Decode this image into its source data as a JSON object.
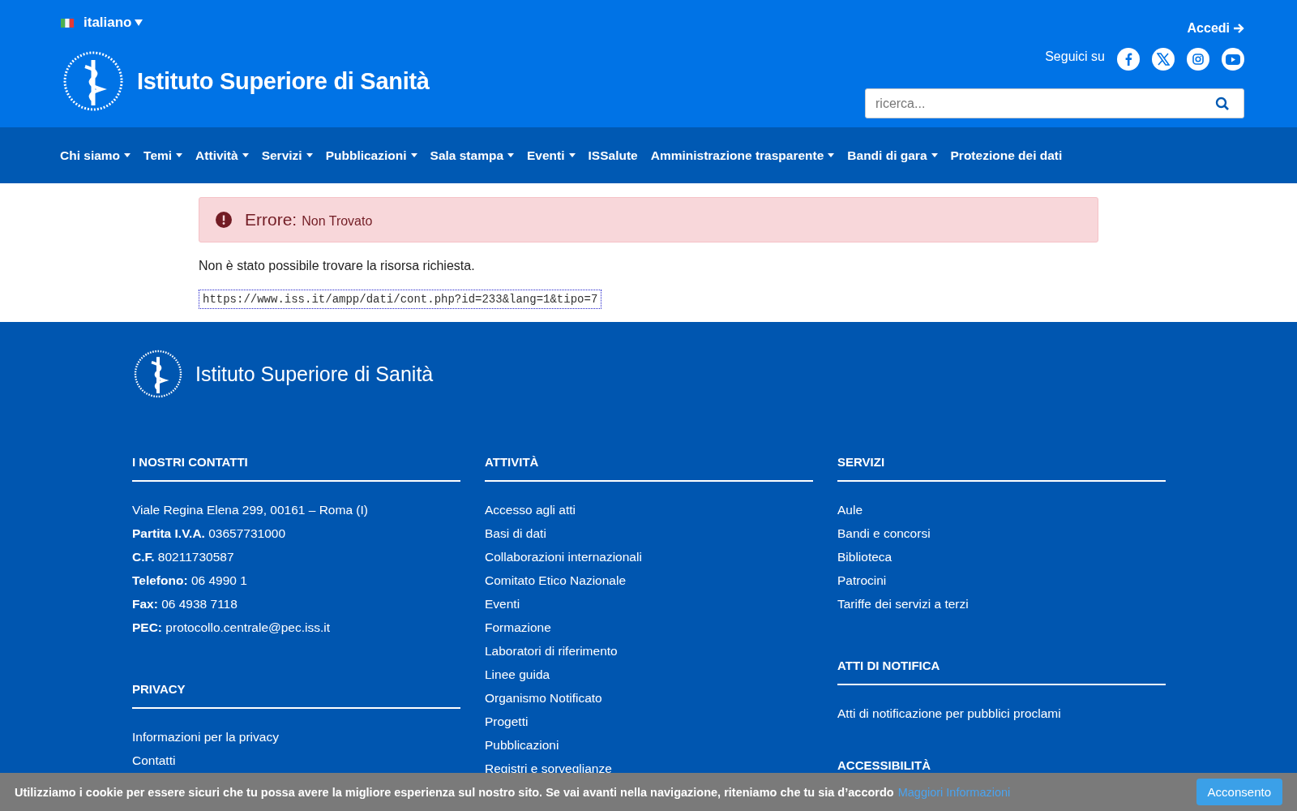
{
  "header": {
    "language": "italiano",
    "login": "Accedi",
    "site_title": "Istituto Superiore di Sanità",
    "follow_label": "Seguici su",
    "socials": [
      {
        "kind": "facebook"
      },
      {
        "kind": "x"
      },
      {
        "kind": "instagram"
      },
      {
        "kind": "youtube"
      }
    ],
    "search": {
      "placeholder": "ricerca..."
    }
  },
  "nav": [
    {
      "label": "Chi siamo",
      "dropdown": true
    },
    {
      "label": "Temi",
      "dropdown": true
    },
    {
      "label": "Attività",
      "dropdown": true
    },
    {
      "label": "Servizi",
      "dropdown": true
    },
    {
      "label": "Pubblicazioni",
      "dropdown": true
    },
    {
      "label": "Sala stampa",
      "dropdown": true
    },
    {
      "label": "Eventi",
      "dropdown": true
    },
    {
      "label": "ISSalute",
      "dropdown": false
    },
    {
      "label": "Amministrazione trasparente",
      "dropdown": true
    },
    {
      "label": "Bandi di gara",
      "dropdown": true
    },
    {
      "label": "Protezione dei dati",
      "dropdown": false
    }
  ],
  "error": {
    "title": "Errore:",
    "message": "Non Trovato",
    "description": "Non è stato possibile trovare la risorsa richiesta.",
    "url": "https://www.iss.it/ampp/dati/cont.php?id=233&lang=1&tipo=7"
  },
  "footer": {
    "site_title": "Istituto Superiore di Sanità",
    "columns": [
      {
        "sections": [
          {
            "heading": "I NOSTRI CONTATTI",
            "items": [
              "Viale Regina Elena 299, 00161 – Roma (I)",
              "**Partita I.V.A.** 03657731000",
              "**C.F.** 80211730587",
              "**Telefono:** 06 4990 1",
              "**Fax:** 06 4938 7118",
              "**PEC:** protocollo.centrale@pec.iss.it"
            ]
          },
          {
            "heading": "PRIVACY",
            "items": [
              "Informazioni per la privacy",
              "Contatti"
            ]
          }
        ]
      },
      {
        "sections": [
          {
            "heading": "ATTIVITÀ",
            "items": [
              "Accesso agli atti",
              "Basi di dati",
              "Collaborazioni internazionali",
              "Comitato Etico Nazionale",
              "Eventi",
              "Formazione",
              "Laboratori di riferimento",
              "Linee guida",
              "Organismo Notificato",
              "Progetti",
              "Pubblicazioni",
              "Registri e sorveglianze"
            ]
          }
        ]
      },
      {
        "sections": [
          {
            "heading": "SERVIZI",
            "items": [
              "Aule",
              "Bandi e concorsi",
              "Biblioteca",
              "Patrocini",
              "Tariffe dei servizi a terzi"
            ]
          },
          {
            "heading": "ATTI DI NOTIFICA",
            "items": [
              "Atti di notificazione per pubblici proclami"
            ]
          },
          {
            "heading": "ACCESSIBILITÀ"
          }
        ]
      }
    ]
  },
  "cookie_bar": {
    "text": "Utilizziamo i cookie per essere sicuri che tu possa avere la migliore esperienza sul nostro sito. Se vai avanti nella navigazione, riteniamo che tu sia d’accordo",
    "link": "Maggiori Informazioni",
    "button": "Acconsento"
  }
}
